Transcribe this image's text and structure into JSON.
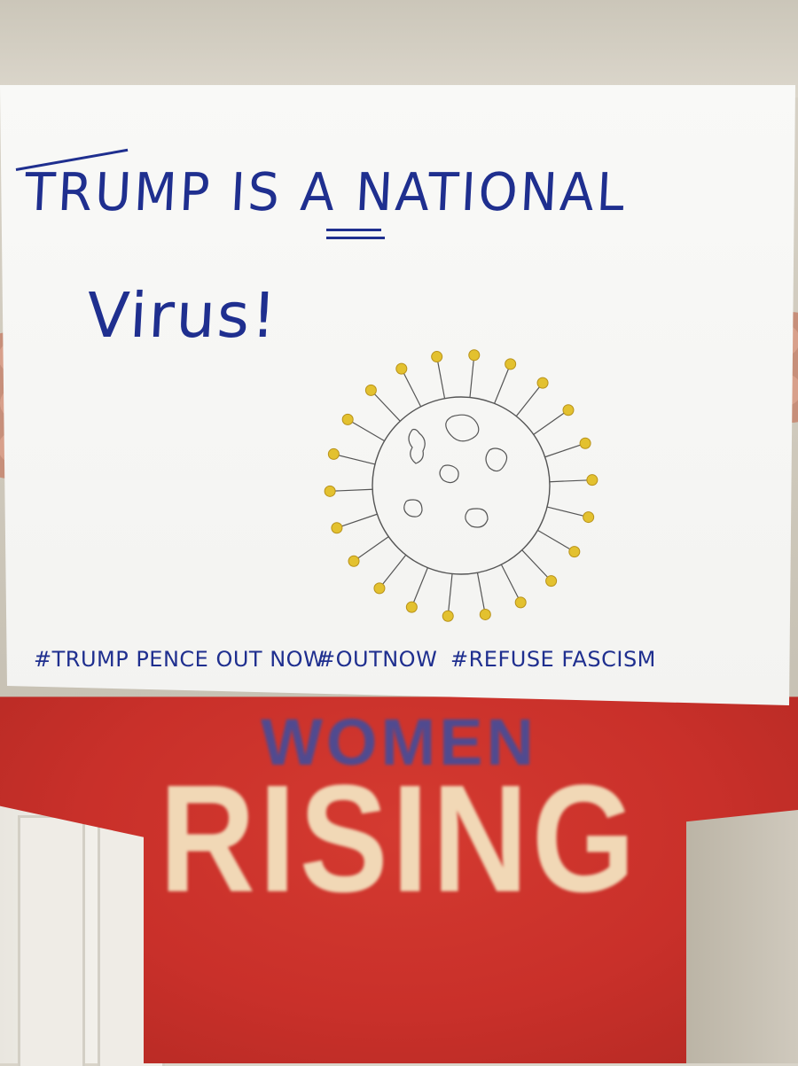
{
  "sign": {
    "title_line1": "TRUMP IS A NATIONAL",
    "title_line2": "Virus!",
    "hashtags": [
      "#TRUMP PENCE OUT NOW",
      "#OUTNOW",
      "#REFUSE FASCISM"
    ]
  },
  "shirt": {
    "line1": "WOMEN",
    "line2": "RISING"
  },
  "colors": {
    "ink": "#1f2f8f",
    "virus_tip": "#e3c12f",
    "shirt": "#c9302a"
  }
}
